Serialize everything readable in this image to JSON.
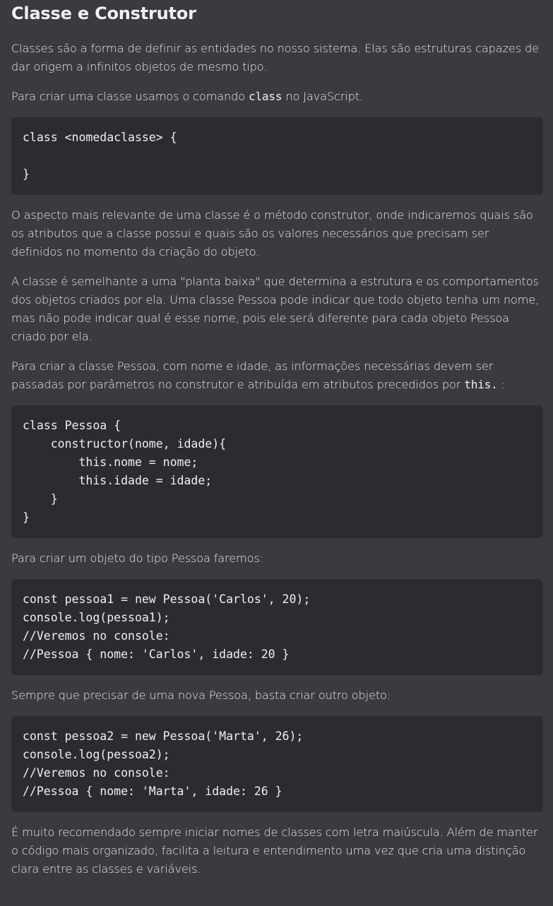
{
  "title": "Classe e Construtor",
  "p1": "Classes são a forma de definir as entidades no nosso sistema. Elas são estruturas capazes de dar origem a infinitos objetos de mesmo tipo.",
  "p2_before": "Para criar uma classe usamos o comando ",
  "p2_code": "class",
  "p2_after": " no JavaScript.",
  "code1": "class <nomedaclasse> {\n\n}",
  "p3": "O aspecto mais relevante de uma classe é o método construtor, onde indicaremos quais são os atributos que a classe possui e quais são os valores necessários que precisam ser definidos no momento da criação do objeto.",
  "p4": "A classe é semelhante a uma \"planta baixa\" que determina a estrutura e os comportamentos dos objetos criados por ela. Uma classe Pessoa pode indicar que todo objeto tenha um nome, mas não pode indicar qual é esse nome, pois ele será diferente para cada objeto Pessoa criado por ela.",
  "p5_before": "Para criar a classe Pessoa, com nome e idade, as informações necessárias devem ser passadas por parâmetros no construtor e atribuída em atributos precedidos por ",
  "p5_code": "this.",
  "p5_after": " :",
  "code2": "class Pessoa {\n    constructor(nome, idade){\n        this.nome = nome;\n        this.idade = idade;\n    }\n}",
  "p6": "Para criar um objeto do tipo Pessoa faremos:",
  "code3": "const pessoa1 = new Pessoa('Carlos', 20);\nconsole.log(pessoa1);\n//Veremos no console:\n//Pessoa { nome: 'Carlos', idade: 20 }",
  "p7": "Sempre que precisar de uma nova Pessoa, basta criar outro objeto:",
  "code4": "const pessoa2 = new Pessoa('Marta', 26);\nconsole.log(pessoa2);\n//Veremos no console:\n//Pessoa { nome: 'Marta', idade: 26 }",
  "p8": "É muito recomendado sempre iniciar nomes de classes com letra maiúscula. Além de manter o código mais organizado, facilita a leitura e entendimento uma vez que cria uma distinção clara entre as classes e variáveis."
}
